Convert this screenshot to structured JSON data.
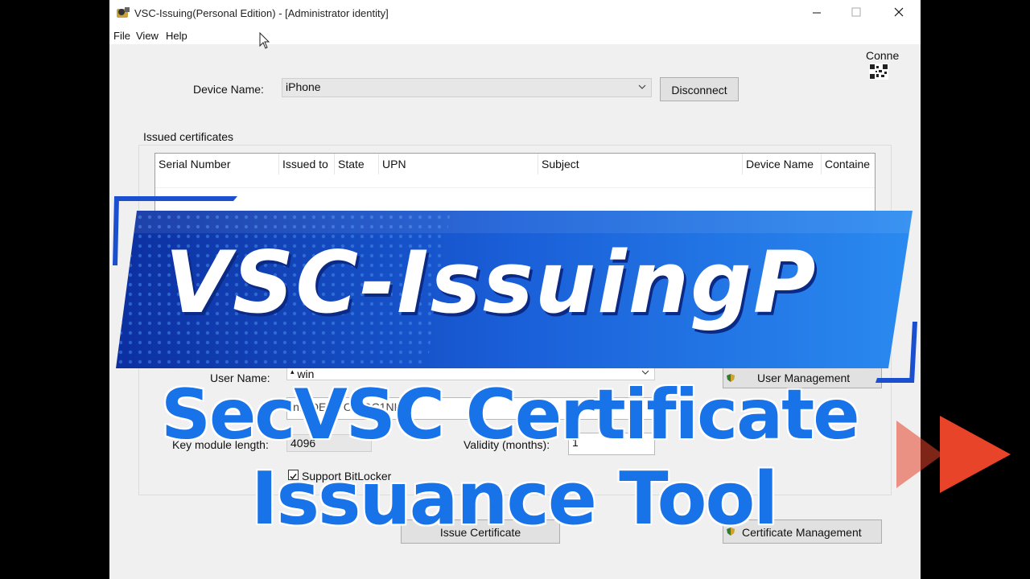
{
  "window": {
    "title": "VSC-Issuing(Personal Edition) - [Administrator identity]",
    "menu": [
      "File",
      "View",
      "Help"
    ]
  },
  "connect": {
    "label": "Conne"
  },
  "device": {
    "label": "Device Name:",
    "value": "iPhone",
    "disconnect_label": "Disconnect"
  },
  "certificates": {
    "group_label": "Issued certificates",
    "columns": [
      "Serial Number",
      "Issued to",
      "State",
      "UPN",
      "Subject",
      "Device Name",
      "Containe"
    ]
  },
  "user": {
    "label": "User Name:",
    "value": "win",
    "management_label": "User Management"
  },
  "partial": {
    "field_value": "in(   )OE   KTOP   OC1NKO",
    "key_label": "Key module length:",
    "key_value": "4096",
    "validity_label": "Validity (months):",
    "validity_value": "1"
  },
  "bitlocker": {
    "label": "Support BitLocker",
    "checked": true
  },
  "actions": {
    "issue_label": "Issue Certificate",
    "cert_management_label": "Certificate Management"
  },
  "banner": {
    "title": "VSC-IssuingP",
    "subtitle_line1": "SecVSC Certificate",
    "subtitle_line2": "Issuance Tool"
  },
  "colors": {
    "banner_blue": "#1a5fd8",
    "overlay_blue": "#1873e8",
    "arrow_red": "#e8442a"
  },
  "icons": {
    "app": "app-icon",
    "qr": "qr-code-icon",
    "shield": "shield-icon",
    "cursor": "cursor-icon",
    "next": "next-arrow-icon"
  }
}
